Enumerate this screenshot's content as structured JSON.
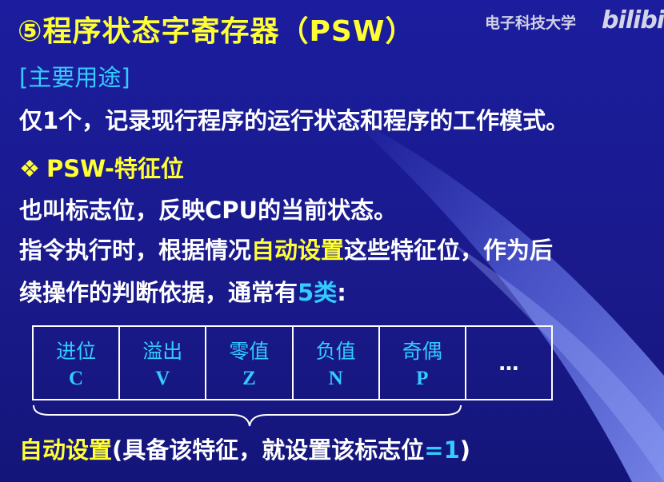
{
  "title": "⑤程序状态字寄存器（PSW）",
  "watermark": {
    "school": "电子科技大学",
    "logo": "bilibili"
  },
  "usage_heading": "[主要用途]",
  "line1": "仅1个，记录现行程序的运行状态和程序的工作模式。",
  "psw_heading": {
    "bullet": "❖",
    "text": "PSW-特征位"
  },
  "line2": "也叫标志位，反映CPU的当前状态。",
  "line3": {
    "before": "指令执行时，根据情况",
    "highlight": "自动设置",
    "after": "这些特征位，作为后"
  },
  "line4": {
    "before": "续操作的判断依据，通常有",
    "count": "5类",
    "after": ":"
  },
  "flags": [
    {
      "name": "进位",
      "letter": "C"
    },
    {
      "name": "溢出",
      "letter": "V"
    },
    {
      "name": "零值",
      "letter": "Z"
    },
    {
      "name": "负值",
      "letter": "N"
    },
    {
      "name": "奇偶",
      "letter": "P"
    }
  ],
  "flags_more": "…",
  "footer": {
    "highlight": "自动设置",
    "text": "(具备该特征，就设置该标志位",
    "eq": "=1",
    "close": ")"
  },
  "colors": {
    "background": "#1b1d9e",
    "title": "#ffff33",
    "accent": "#33ccff",
    "text": "#ffffff"
  }
}
